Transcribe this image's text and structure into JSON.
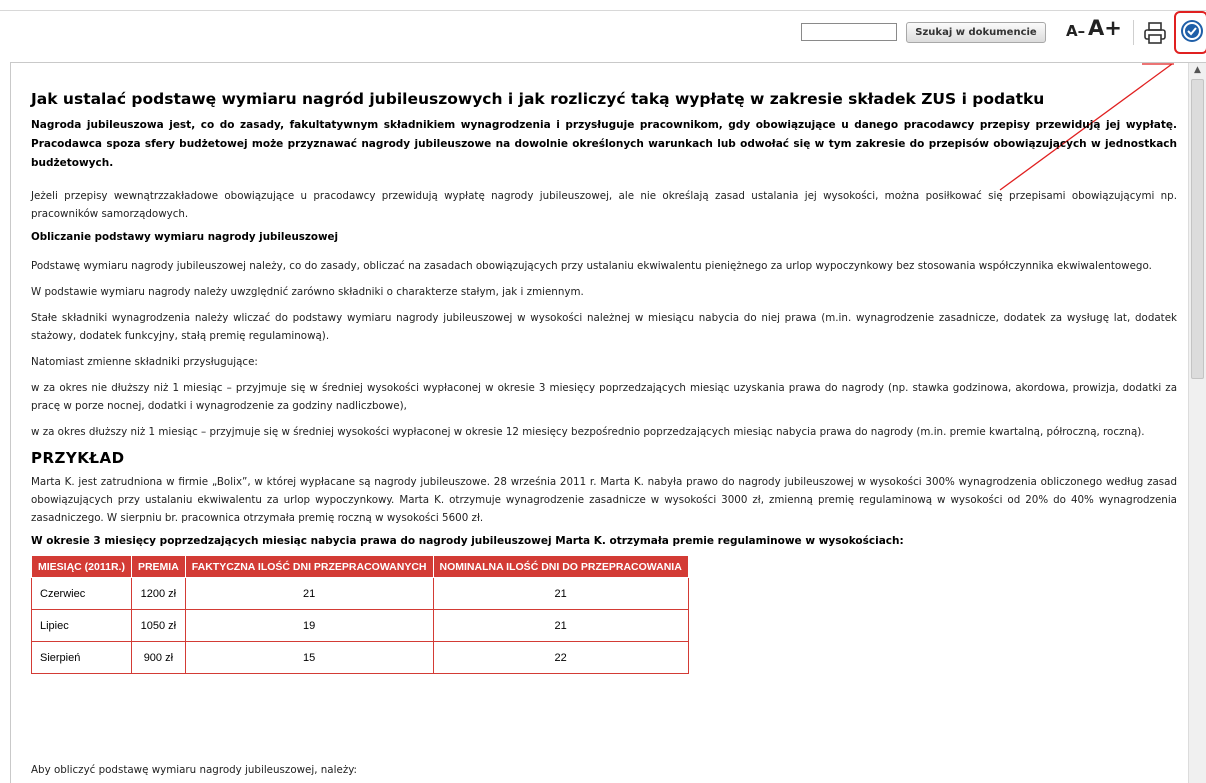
{
  "toolbar": {
    "search_value": "",
    "search_button_label": "Szukaj w dokumencie",
    "font_decrease_label": "A–",
    "font_increase_label": "A+",
    "print_icon": "printer-icon",
    "help_icon": "help-badge-icon",
    "highlight_color": "#e02020"
  },
  "document": {
    "title": "Jak ustalać podstawę wymiaru nagród jubileuszowych i jak rozliczyć taką wypłatę w zakresie składek ZUS i podatku",
    "lead": "Nagroda jubileuszowa jest, co do zasady, fakultatywnym składnikiem wynagrodzenia i przysługuje pracownikom, gdy obowiązujące u danego pracodawcy przepisy przewidują jej wypłatę. Pracodawca spoza sfery budżetowej może przyznawać nagrody jubileuszowe na dowolnie określonych warunkach lub odwołać się w tym zakresie do przepisów obowiązujących w jednostkach budżetowych.",
    "para1": "Jeżeli przepisy wewnątrzzakładowe obowiązujące u pracodawcy przewidują wypłatę nagrody jubileuszowej, ale nie określają zasad ustalania jej wysokości, można posiłkować się przepisami obowiązującymi np. pracowników samorządowych.",
    "subheading": "Obliczanie podstawy wymiaru nagrody jubileuszowej",
    "para2": "Podstawę wymiaru nagrody jubileuszowej należy, co do zasady, obliczać na zasadach obowiązujących przy ustalaniu ekwiwalentu pieniężnego za urlop wypoczynkowy bez stosowania współczynnika ekwiwalentowego.",
    "para3": "W podstawie wymiaru nagrody należy uwzględnić zarówno składniki o charakterze stałym, jak i zmiennym.",
    "para4": "Stałe składniki wynagrodzenia należy wliczać do podstawy wymiaru nagrody jubileuszowej w wysokości należnej w miesiącu nabycia do niej prawa (m.in. wynagrodzenie zasadnicze, dodatek za wysługę lat, dodatek stażowy, dodatek funkcyjny, stałą premię regulaminową).",
    "para5": "Natomiast zmienne składniki przysługujące:",
    "para6": "w za okres nie dłuższy niż 1 miesiąc – przyjmuje się w średniej wysokości wypłaconej w okresie 3 miesięcy poprzedzających miesiąc uzyskania prawa do nagrody (np. stawka godzinowa, akordowa, prowizja, dodatki za pracę w porze nocnej, dodatki i wynagrodzenie za godziny nadliczbowe),",
    "para7": "w za okres dłuższy niż 1 miesiąc – przyjmuje się w średniej wysokości wypłaconej w okresie 12 miesięcy bezpośrednio poprzedzających miesiąc nabycia prawa do nagrody (m.in. premie kwartalną, półroczną, roczną).",
    "example_title": "PRZYKŁAD",
    "example_text": "Marta K. jest zatrudniona w firmie „Bolix”, w której wypłacane są nagrody jubileuszowe. 28 września 2011 r. Marta K. nabyła prawo do nagrody jubileuszowej w wysokości 300% wynagrodzenia obliczonego według zasad obowiązujących przy ustalaniu ekwiwalentu za urlop wypoczynkowy. Marta K. otrzymuje wynagrodzenie zasadnicze w wysokości 3000 zł, zmienną premię regulaminową w wysokości od 20% do 40% wynagrodzenia zasadniczego. W sierpniu br. pracownica otrzymała premię roczną w wysokości 5600 zł.",
    "table_intro": "W okresie 3 miesięcy poprzedzających miesiąc nabycia prawa do nagrody jubileuszowej Marta K. otrzymała premie regulaminowe w wysokościach:",
    "last_line": "Aby obliczyć podstawę wymiaru nagrody jubileuszowej, należy:"
  },
  "table": {
    "header_color": "#d33b35",
    "headers": [
      "MIESIĄC (2011R.)",
      "PREMIA",
      "FAKTYCZNA ILOŚĆ DNI PRZEPRACOWANYCH",
      "NOMINALNA ILOŚĆ DNI DO PRZEPRACOWANIA"
    ],
    "rows": [
      [
        "Czerwiec",
        "1200 zł",
        "21",
        "21"
      ],
      [
        "Lipiec",
        "1050 zł",
        "19",
        "21"
      ],
      [
        "Sierpień",
        "900 zł",
        "15",
        "22"
      ]
    ]
  }
}
